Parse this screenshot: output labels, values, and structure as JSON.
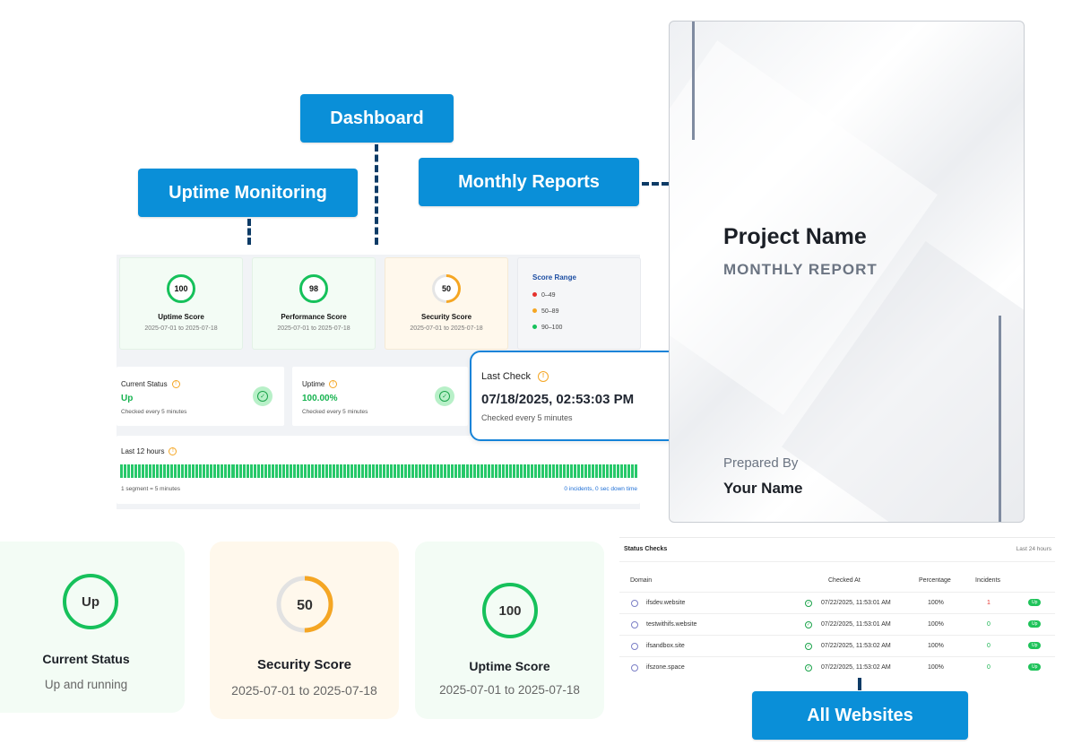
{
  "tags": {
    "dashboard": "Dashboard",
    "uptime_monitoring": "Uptime Monitoring",
    "monthly_reports": "Monthly Reports",
    "all_websites": "All Websites"
  },
  "score_cards": [
    {
      "value": "100",
      "label": "Uptime Score",
      "range": "2025-07-01 to 2025-07-18",
      "color": "#16c15b"
    },
    {
      "value": "98",
      "label": "Performance Score",
      "range": "2025-07-01 to 2025-07-18",
      "color": "#16c15b"
    },
    {
      "value": "50",
      "label": "Security Score",
      "range": "2025-07-01 to 2025-07-18",
      "color": "#f5a623"
    }
  ],
  "score_range": {
    "title": "Score Range",
    "items": [
      {
        "label": "0–49",
        "color": "#e5322d"
      },
      {
        "label": "50–89",
        "color": "#f5a623"
      },
      {
        "label": "90–100",
        "color": "#16c15b"
      }
    ]
  },
  "current_status": {
    "title": "Current Status",
    "value": "Up",
    "sub": "Checked every 5 minutes"
  },
  "uptime": {
    "title": "Uptime",
    "value": "100.00%",
    "sub": "Checked every 5 minutes"
  },
  "last_check": {
    "title": "Last Check",
    "value": "07/18/2025, 02:53:03 PM",
    "sub": "Checked every 5 minutes"
  },
  "last12": {
    "title": "Last 12 hours",
    "legend": "1 segment = 5 minutes",
    "summary": "0 incidents, 0 sec down time",
    "segments": 144
  },
  "report": {
    "project": "Project Name",
    "subtitle": "MONTHLY REPORT",
    "prepared_by_label": "Prepared By",
    "prepared_by": "Your Name"
  },
  "bottom_cards": [
    {
      "ring": "Up",
      "title": "Current Status",
      "sub": "Up and running"
    },
    {
      "ring": "50",
      "title": "Security Score",
      "sub": "2025-07-01 to 2025-07-18",
      "progress": 0.5
    },
    {
      "ring": "100",
      "title": "Uptime Score",
      "sub": "2025-07-01 to 2025-07-18"
    }
  ],
  "status_checks": {
    "title": "Status Checks",
    "period": "Last 24 hours",
    "headers": [
      "Domain",
      "Checked At",
      "Percentage",
      "Incidents"
    ],
    "rows": [
      {
        "domain": "ifsdev.website",
        "checked": "07/22/2025, 11:53:01 AM",
        "pct": "100%",
        "incidents": "1",
        "status": "Up"
      },
      {
        "domain": "testwithifs.website",
        "checked": "07/22/2025, 11:53:01 AM",
        "pct": "100%",
        "incidents": "0",
        "status": "Up"
      },
      {
        "domain": "ifsandbox.site",
        "checked": "07/22/2025, 11:53:02 AM",
        "pct": "100%",
        "incidents": "0",
        "status": "Up"
      },
      {
        "domain": "ifszone.space",
        "checked": "07/22/2025, 11:53:02 AM",
        "pct": "100%",
        "incidents": "0",
        "status": "Up"
      }
    ]
  },
  "colors": {
    "accent": "#0a8fd8",
    "connector": "#0d3b66",
    "green": "#16c15b",
    "orange": "#f5a623"
  }
}
